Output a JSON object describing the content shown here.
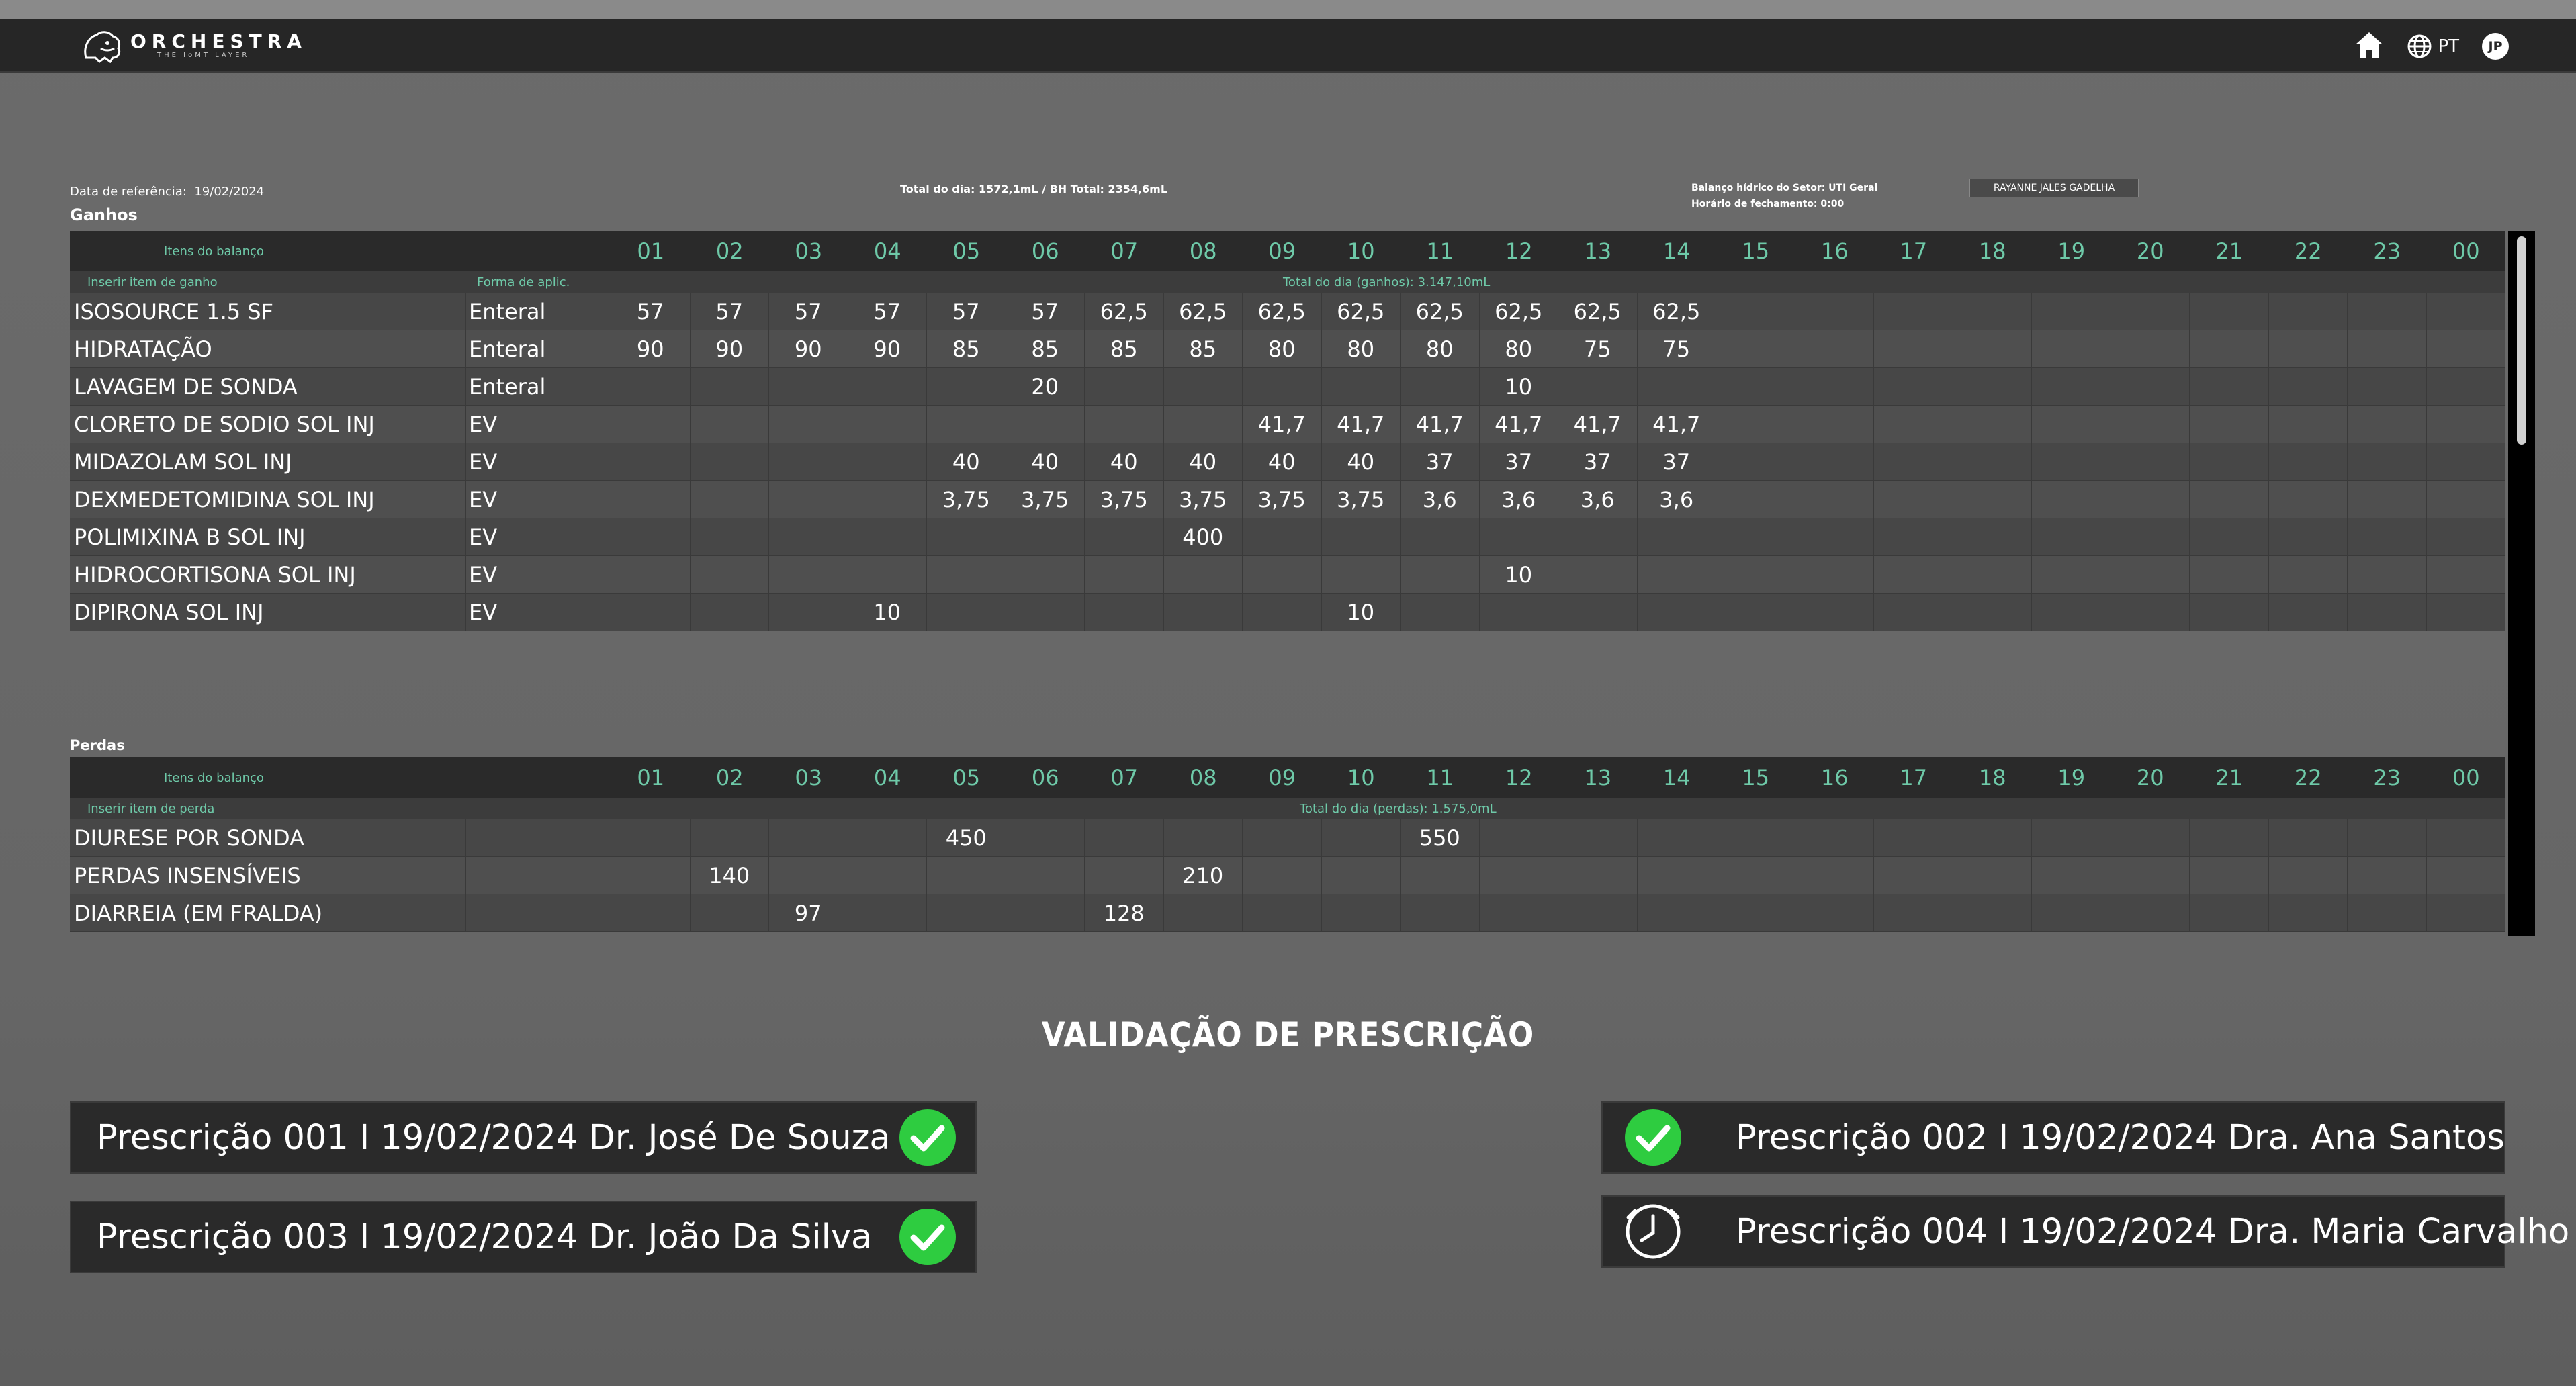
{
  "app": {
    "brand": "ORCHESTRA",
    "tagline": "THE IoMT LAYER",
    "language": "PT",
    "user_initials": "JP"
  },
  "header": {
    "reference_label": "Data de referência:",
    "reference_date": "19/02/2024",
    "day_total": "Total do dia: 1572,1mL / BH Total: 2354,6mL",
    "sector_line": "Balanço hídrico do Setor: UTI Geral",
    "closing_line": "Horário de fechamento: 0:00",
    "user_name": "RAYANNE JALES GADELHA"
  },
  "hours": [
    "01",
    "02",
    "03",
    "04",
    "05",
    "06",
    "07",
    "08",
    "09",
    "10",
    "11",
    "12",
    "13",
    "14",
    "15",
    "16",
    "17",
    "18",
    "19",
    "20",
    "21",
    "22",
    "23",
    "00"
  ],
  "gains": {
    "title": "Ganhos",
    "items_header": "Itens do balanço",
    "insert_placeholder": "Inserir item de ganho",
    "form_header": "Forma de aplic.",
    "total_label": "Total do dia (ganhos): 3.147,10mL",
    "rows": [
      {
        "name": "ISOSOURCE 1.5 SF",
        "form": "Enteral",
        "values": [
          "57",
          "57",
          "57",
          "57",
          "57",
          "57",
          "62,5",
          "62,5",
          "62,5",
          "62,5",
          "62,5",
          "62,5",
          "62,5",
          "62,5",
          "",
          "",
          "",
          "",
          "",
          "",
          "",
          "",
          "",
          ""
        ]
      },
      {
        "name": "HIDRATAÇÃO",
        "form": "Enteral",
        "values": [
          "90",
          "90",
          "90",
          "90",
          "85",
          "85",
          "85",
          "85",
          "80",
          "80",
          "80",
          "80",
          "75",
          "75",
          "",
          "",
          "",
          "",
          "",
          "",
          "",
          "",
          "",
          ""
        ]
      },
      {
        "name": "LAVAGEM DE SONDA",
        "form": "Enteral",
        "values": [
          "",
          "",
          "",
          "",
          "",
          "20",
          "",
          "",
          "",
          "",
          "",
          "10",
          "",
          "",
          "",
          "",
          "",
          "",
          "",
          "",
          "",
          "",
          "",
          ""
        ]
      },
      {
        "name": "CLORETO DE SODIO SOL INJ",
        "form": "EV",
        "values": [
          "",
          "",
          "",
          "",
          "",
          "",
          "",
          "",
          "41,7",
          "41,7",
          "41,7",
          "41,7",
          "41,7",
          "41,7",
          "",
          "",
          "",
          "",
          "",
          "",
          "",
          "",
          "",
          ""
        ]
      },
      {
        "name": "MIDAZOLAM SOL INJ",
        "form": "EV",
        "values": [
          "",
          "",
          "",
          "",
          "40",
          "40",
          "40",
          "40",
          "40",
          "40",
          "37",
          "37",
          "37",
          "37",
          "",
          "",
          "",
          "",
          "",
          "",
          "",
          "",
          "",
          ""
        ]
      },
      {
        "name": "DEXMEDETOMIDINA SOL INJ",
        "form": "EV",
        "values": [
          "",
          "",
          "",
          "",
          "3,75",
          "3,75",
          "3,75",
          "3,75",
          "3,75",
          "3,75",
          "3,6",
          "3,6",
          "3,6",
          "3,6",
          "",
          "",
          "",
          "",
          "",
          "",
          "",
          "",
          "",
          ""
        ]
      },
      {
        "name": "POLIMIXINA B SOL INJ",
        "form": "EV",
        "values": [
          "",
          "",
          "",
          "",
          "",
          "",
          "",
          "400",
          "",
          "",
          "",
          "",
          "",
          "",
          "",
          "",
          "",
          "",
          "",
          "",
          "",
          "",
          "",
          ""
        ]
      },
      {
        "name": "HIDROCORTISONA SOL INJ",
        "form": "EV",
        "values": [
          "",
          "",
          "",
          "",
          "",
          "",
          "",
          "",
          "",
          "",
          "",
          "10",
          "",
          "",
          "",
          "",
          "",
          "",
          "",
          "",
          "",
          "",
          "",
          ""
        ]
      },
      {
        "name": "DIPIRONA SOL INJ",
        "form": "EV",
        "values": [
          "",
          "",
          "",
          "10",
          "",
          "",
          "",
          "",
          "",
          "10",
          "",
          "",
          "",
          "",
          "",
          "",
          "",
          "",
          "",
          "",
          "",
          "",
          "",
          ""
        ]
      }
    ]
  },
  "losses": {
    "title": "Perdas",
    "items_header": "Itens do balanço",
    "insert_placeholder": "Inserir item de perda",
    "total_label": "Total do dia (perdas): 1.575,0mL",
    "rows": [
      {
        "name": "DIURESE POR SONDA",
        "form": "",
        "values": [
          "",
          "",
          "",
          "",
          "450",
          "",
          "",
          "",
          "",
          "",
          "550",
          "",
          "",
          "",
          "",
          "",
          "",
          "",
          "",
          "",
          "",
          "",
          "",
          ""
        ]
      },
      {
        "name": "PERDAS INSENSÍVEIS",
        "form": "",
        "values": [
          "",
          "140",
          "",
          "",
          "",
          "",
          "",
          "210",
          "",
          "",
          "",
          "",
          "",
          "",
          "",
          "",
          "",
          "",
          "",
          "",
          "",
          "",
          "",
          ""
        ]
      },
      {
        "name": "DIARREIA (EM FRALDA)",
        "form": "",
        "values": [
          "",
          "",
          "97",
          "",
          "",
          "",
          "128",
          "",
          "",
          "",
          "",
          "",
          "",
          "",
          "",
          "",
          "",
          "",
          "",
          "",
          "",
          "",
          "",
          ""
        ]
      }
    ]
  },
  "validation": {
    "title": "VALIDAÇÃO DE PRESCRIÇÃO",
    "prescriptions": [
      {
        "text": "Prescrição 001 I 19/02/2024 Dr. José De Souza",
        "status": "check-icon"
      },
      {
        "text": "Prescrição 002 I 19/02/2024 Dra. Ana Santos",
        "status": "check-icon"
      },
      {
        "text": "Prescrição 003 I 19/02/2024 Dr. João Da Silva",
        "status": "check-icon"
      },
      {
        "text": "Prescrição 004 I 19/02/2024 Dra. Maria Carvalho",
        "status": "clock-icon"
      }
    ]
  },
  "colors": {
    "accent": "#6ec9a8",
    "check": "#2ecc40",
    "bar": "#262626",
    "background": "#6b6b6b"
  }
}
